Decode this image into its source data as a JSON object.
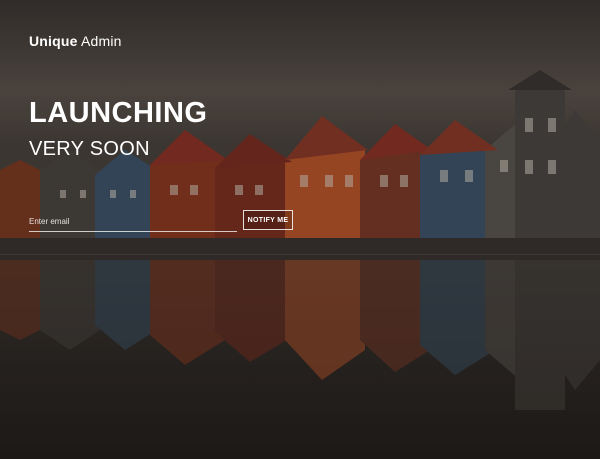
{
  "brand": {
    "bold": "Unique",
    "light": "Admin"
  },
  "hero": {
    "title": "LAUNCHING",
    "subtitle": "VERY SOON"
  },
  "signup": {
    "email_placeholder": "Enter email",
    "button_label": "NOTIFY ME"
  },
  "colors": {
    "text": "#ffffff",
    "sky": "#4a4540",
    "water": "#2b2724",
    "house_red": "#8a3a22",
    "house_blue": "#3d5468",
    "house_gray": "#4a4642"
  }
}
